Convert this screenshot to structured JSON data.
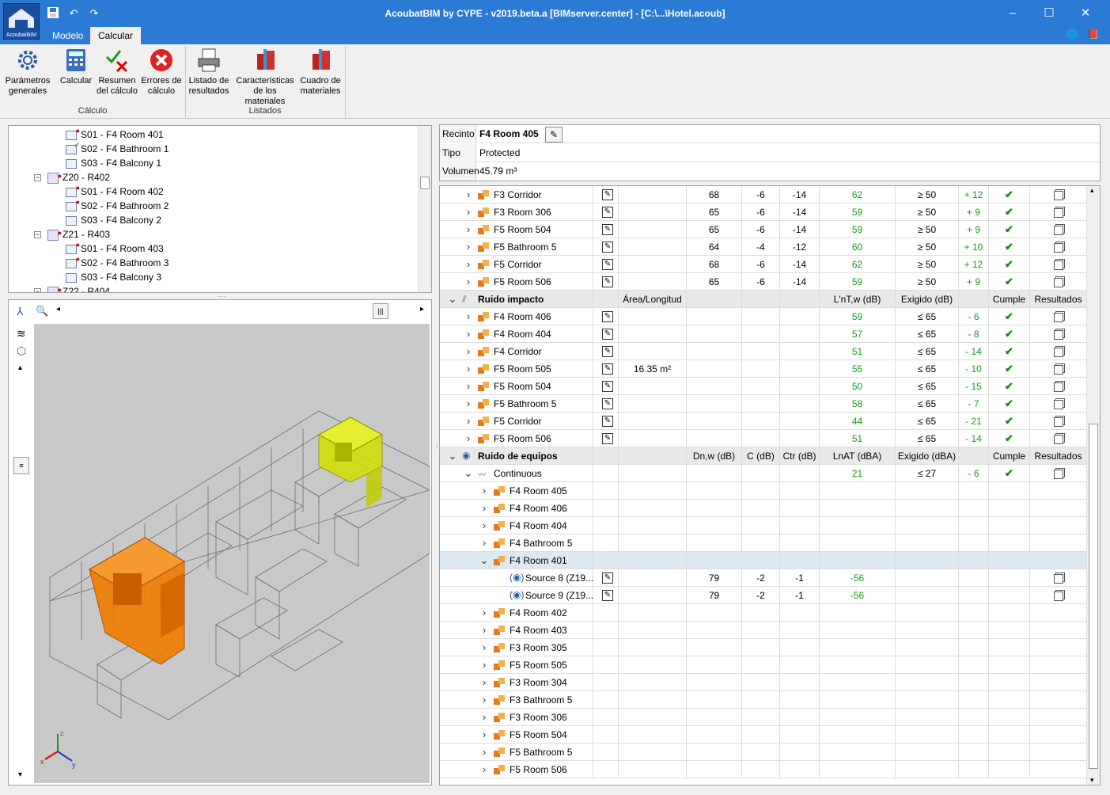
{
  "window": {
    "title": "AcoubatBIM by CYPE - v2019.beta.a [BIMserver.center] - [C:\\...\\Hotel.acoub]",
    "logo_text": "AcoubatBIM",
    "minimize": "–",
    "maximize": "☐",
    "close": "✕"
  },
  "tabs": [
    {
      "label": "Modelo"
    },
    {
      "label": "Calcular"
    }
  ],
  "ribbon": {
    "parametros": "Parámetros generales",
    "calcular": "Calcular",
    "resumen": "Resumen del cálculo",
    "errores": "Errores de cálculo",
    "listado": "Listado de resultados",
    "caracteristicas": "Características de los materiales",
    "cuadro": "Cuadro de materiales",
    "group_calculo": "Cálculo",
    "group_listados": "Listados"
  },
  "tree": {
    "items": [
      {
        "label": "S01 - F4 Room 401",
        "level": 2,
        "status": "error"
      },
      {
        "label": "S02 - F4 Bathroom 1",
        "level": 2,
        "status": "ok"
      },
      {
        "label": "S03 - F4 Balcony 1",
        "level": 2,
        "status": "none"
      },
      {
        "label": "Z20 - R402",
        "level": 1,
        "status": "zone"
      },
      {
        "label": "S01 - F4 Room 402",
        "level": 2,
        "status": "error"
      },
      {
        "label": "S02 - F4 Bathroom 2",
        "level": 2,
        "status": "error"
      },
      {
        "label": "S03 - F4 Balcony 2",
        "level": 2,
        "status": "none"
      },
      {
        "label": "Z21 - R403",
        "level": 1,
        "status": "zone"
      },
      {
        "label": "S01 - F4 Room 403",
        "level": 2,
        "status": "error"
      },
      {
        "label": "S02 - F4 Bathroom 3",
        "level": 2,
        "status": "error"
      },
      {
        "label": "S03 - F4 Balcony 3",
        "level": 2,
        "status": "none"
      },
      {
        "label": "Z22 - R404",
        "level": 1,
        "status": "zone"
      }
    ]
  },
  "info": {
    "recinto_label": "Recinto",
    "recinto_value": "F4 Room 405",
    "tipo_label": "Tipo",
    "tipo_value": "Protected",
    "volumen_label": "Volumen",
    "volumen_value": "45.79 m³"
  },
  "grid": {
    "airborne_rows": [
      {
        "name": "F3 Corridor",
        "d": "68",
        "c": "-6",
        "ctr": "-14",
        "val": "62",
        "req": "≥ 50",
        "margin": "+ 12"
      },
      {
        "name": "F3 Room 306",
        "d": "65",
        "c": "-6",
        "ctr": "-14",
        "val": "59",
        "req": "≥ 50",
        "margin": "+ 9"
      },
      {
        "name": "F5 Room 504",
        "d": "65",
        "c": "-6",
        "ctr": "-14",
        "val": "59",
        "req": "≥ 50",
        "margin": "+ 9"
      },
      {
        "name": "F5 Bathroom 5",
        "d": "64",
        "c": "-4",
        "ctr": "-12",
        "val": "60",
        "req": "≥ 50",
        "margin": "+ 10"
      },
      {
        "name": "F5 Corridor",
        "d": "68",
        "c": "-6",
        "ctr": "-14",
        "val": "62",
        "req": "≥ 50",
        "margin": "+ 12"
      },
      {
        "name": "F5 Room 506",
        "d": "65",
        "c": "-6",
        "ctr": "-14",
        "val": "59",
        "req": "≥ 50",
        "margin": "+ 9"
      }
    ],
    "impact_header": {
      "title": "Ruido impacto",
      "area": "Área/Longitud",
      "val": "L'nT,w (dB)",
      "req": "Exigido (dB)",
      "cumple": "Cumple",
      "resultados": "Resultados"
    },
    "impact_rows": [
      {
        "name": "F4 Room 406",
        "area": "",
        "val": "59",
        "req": "≤ 65",
        "margin": "- 6"
      },
      {
        "name": "F4 Room 404",
        "area": "",
        "val": "57",
        "req": "≤ 65",
        "margin": "- 8"
      },
      {
        "name": "F4 Corridor",
        "area": "",
        "val": "51",
        "req": "≤ 65",
        "margin": "- 14"
      },
      {
        "name": "F5 Room 505",
        "area": "16.35 m²",
        "val": "55",
        "req": "≤ 65",
        "margin": "- 10"
      },
      {
        "name": "F5 Room 504",
        "area": "",
        "val": "50",
        "req": "≤ 65",
        "margin": "- 15"
      },
      {
        "name": "F5 Bathroom 5",
        "area": "",
        "val": "58",
        "req": "≤ 65",
        "margin": "- 7"
      },
      {
        "name": "F5 Corridor",
        "area": "",
        "val": "44",
        "req": "≤ 65",
        "margin": "- 21"
      },
      {
        "name": "F5 Room 506",
        "area": "",
        "val": "51",
        "req": "≤ 65",
        "margin": "- 14"
      }
    ],
    "equip_header": {
      "title": "Ruido de equipos",
      "dn": "Dn,w (dB)",
      "c": "C (dB)",
      "ctr": "Ctr (dB)",
      "val": "LnAT (dBA)",
      "req": "Exigido (dBA)",
      "cumple": "Cumple",
      "resultados": "Resultados"
    },
    "continuous": {
      "name": "Continuous",
      "val": "21",
      "req": "≤ 27",
      "margin": "- 6"
    },
    "equip_rooms_a": [
      "F4 Room 405",
      "F4 Room 406",
      "F4 Room 404",
      "F4 Bathroom 5",
      "F4 Room 401"
    ],
    "sources": [
      {
        "name": "Source 8 (Z19...",
        "d": "79",
        "c": "-2",
        "ctr": "-1",
        "val": "-56"
      },
      {
        "name": "Source 9 (Z19...",
        "d": "79",
        "c": "-2",
        "ctr": "-1",
        "val": "-56"
      }
    ],
    "equip_rooms_b": [
      "F4 Room 402",
      "F4 Room 403",
      "F3 Room 305",
      "F5 Room 505",
      "F3 Room 304",
      "F3 Bathroom 5",
      "F3 Room 306",
      "F5 Room 504",
      "F5 Bathroom 5",
      "F5 Room 506"
    ]
  },
  "colors": {
    "accent": "#2b7bd5",
    "ok_green": "#1a9a1a",
    "selected_room": "#f07d00",
    "target_room": "#d4e000"
  }
}
